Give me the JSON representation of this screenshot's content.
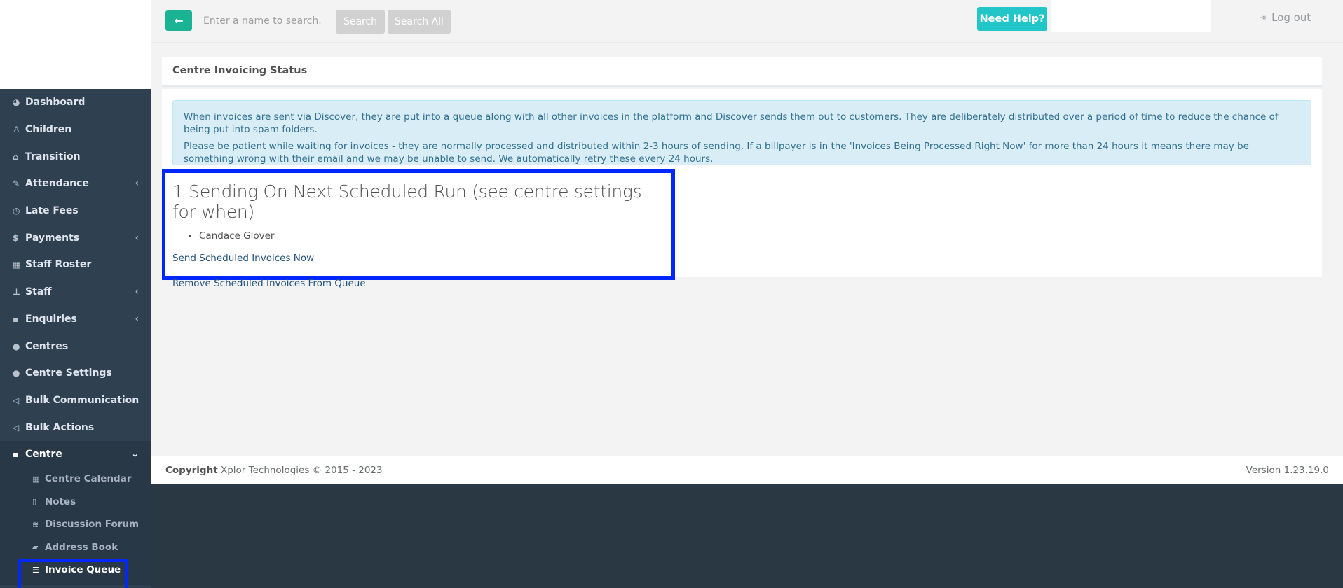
{
  "topbar": {
    "search_placeholder": "Enter a name to search..",
    "search_label": "Search",
    "search_all_label": "Search All",
    "help_label": "Need Help?",
    "logout_label": "Log out"
  },
  "sidebar": {
    "items": [
      {
        "label": "Dashboard",
        "icon": "pie-chart-icon"
      },
      {
        "label": "Children",
        "icon": "child-icon"
      },
      {
        "label": "Transition",
        "icon": "graduation-cap-icon"
      },
      {
        "label": "Attendance",
        "icon": "edit-icon"
      },
      {
        "label": "Late Fees",
        "icon": "clock-icon"
      },
      {
        "label": "Payments",
        "icon": "dollar-icon"
      },
      {
        "label": "Staff Roster",
        "icon": "calendar-icon"
      },
      {
        "label": "Staff",
        "icon": "sitemap-icon"
      },
      {
        "label": "Enquiries",
        "icon": "grid-icon"
      },
      {
        "label": "Centres",
        "icon": "dot-icon"
      },
      {
        "label": "Centre Settings",
        "icon": "dot-icon"
      },
      {
        "label": "Bulk Communication",
        "icon": "bullhorn-icon"
      },
      {
        "label": "Bulk Actions",
        "icon": "bullhorn-icon"
      }
    ],
    "active_section": {
      "label": "Centre",
      "icon": "grid-icon"
    },
    "sub_items": [
      {
        "label": "Centre Calendar",
        "icon": "calendar-icon"
      },
      {
        "label": "Notes",
        "icon": "file-icon"
      },
      {
        "label": "Discussion Forum",
        "icon": "forum-icon"
      },
      {
        "label": "Address Book",
        "icon": "book-icon"
      },
      {
        "label": "Invoice Queue",
        "icon": "list-icon"
      }
    ]
  },
  "main": {
    "panel_title": "Centre Invoicing Status",
    "alert": {
      "line1": "When invoices are sent via Discover, they are put into a queue along with all other invoices in the platform and Discover sends them out to customers. They are deliberately distributed over a period of time to reduce the chance of being put into spam folders.",
      "line2": "Please be patient while waiting for invoices - they are normally processed and distributed within 2-3 hours of sending. If a billpayer is in the 'Invoices Being Processed Right Now' for more than 24 hours it means there may be something wrong with their email and we may be unable to send. We automatically retry these every 24 hours."
    },
    "scheduled": {
      "heading": "1 Sending On Next Scheduled Run (see centre settings for when)",
      "recipients": [
        "Candace Glover"
      ],
      "send_now_label": "Send Scheduled Invoices Now",
      "remove_label": "Remove Scheduled Invoices From Queue"
    }
  },
  "footer": {
    "copyright_label": "Copyright",
    "copyright_text": "Xplor Technologies © 2015 - 2023",
    "version": "Version 1.23.19.0"
  }
}
